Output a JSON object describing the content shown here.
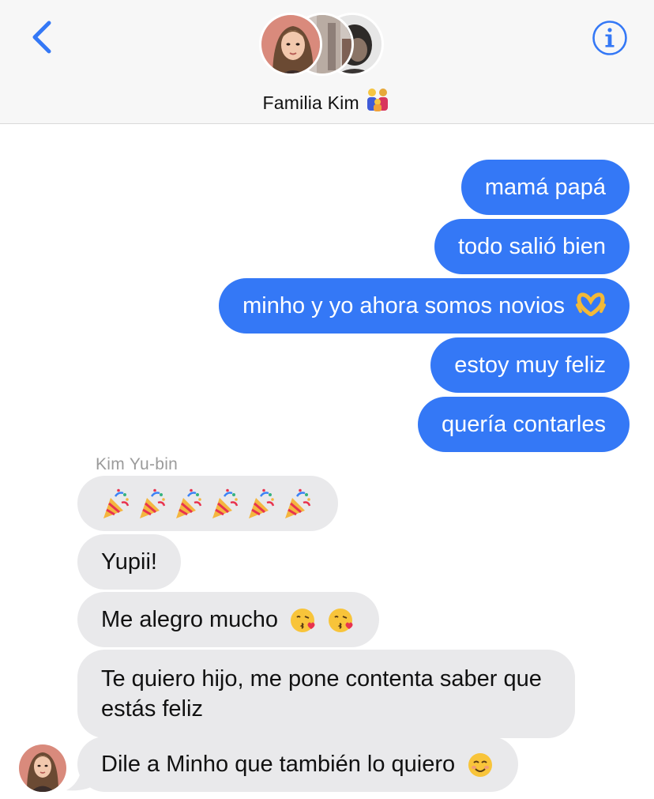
{
  "header": {
    "group_name": "Familia Kim",
    "group_emoji": "👨‍👩‍👦",
    "back_icon": "chevron-left-icon",
    "info_icon": "info-circle-icon"
  },
  "colors": {
    "accent": "#3478f6",
    "incoming_bubble": "#e9e9eb",
    "header_bg": "#f7f7f7"
  },
  "messages": {
    "outgoing": [
      "mamá papá",
      "todo salió bien",
      "minho y yo ahora somos novios",
      "estoy muy feliz",
      "quería contarles"
    ],
    "sender_name": "Kim Yu-bin",
    "incoming": {
      "party_count": 6,
      "yupii": "Yupii!",
      "alegro": "Me alegro mucho",
      "quiero": "Te quiero hijo, me pone contenta saber que estás feliz",
      "dile": "Dile a Minho que también lo quiero"
    }
  }
}
